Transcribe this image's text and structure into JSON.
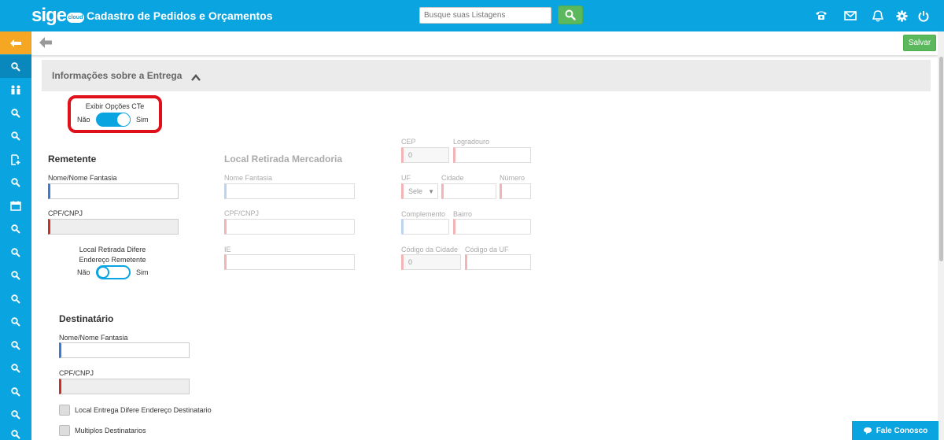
{
  "header": {
    "logo": "sige",
    "logo_badge": "cloud",
    "title": "Cadastro de Pedidos e Orçamentos",
    "search_placeholder": "Busque suas Listagens",
    "icons": [
      "phone-icon",
      "mail-icon",
      "bell-icon",
      "gear-icon",
      "power-icon"
    ]
  },
  "toolbar": {
    "save_label": "Salvar"
  },
  "section": {
    "title": "Informações sobre a Entrega"
  },
  "cte_toggle": {
    "label": "Exibir Opções CTe",
    "off": "Não",
    "on": "Sim",
    "value": true
  },
  "remetente": {
    "heading": "Remetente",
    "name_label": "Nome/Nome Fantasia",
    "cpf_label": "CPF/CNPJ",
    "toggle_label_1": "Local Retirada Difere",
    "toggle_label_2": "Endereço Remetente",
    "off": "Não",
    "on": "Sim"
  },
  "retirada": {
    "heading": "Local Retirada Mercadoria",
    "nome_label": "Nome Fantasia",
    "cpf_label": "CPF/CNPJ",
    "ie_label": "IE",
    "cep_label": "CEP",
    "cep_value": "0",
    "logradouro_label": "Logradouro",
    "uf_label": "UF",
    "uf_value": "Sele",
    "cidade_label": "Cidade",
    "numero_label": "Número",
    "complemento_label": "Complemento",
    "bairro_label": "Bairro",
    "cod_cidade_label": "Código da Cidade",
    "cod_cidade_value": "0",
    "cod_uf_label": "Código da UF"
  },
  "destinatario": {
    "heading": "Destinatário",
    "name_label": "Nome/Nome Fantasia",
    "cpf_label": "CPF/CNPJ",
    "cb1_label": "Local Entrega Difere Endereço Destinatario",
    "cb2_label": "Multiplos Destinatarios"
  },
  "chat": {
    "label": "Fale Conosco"
  }
}
